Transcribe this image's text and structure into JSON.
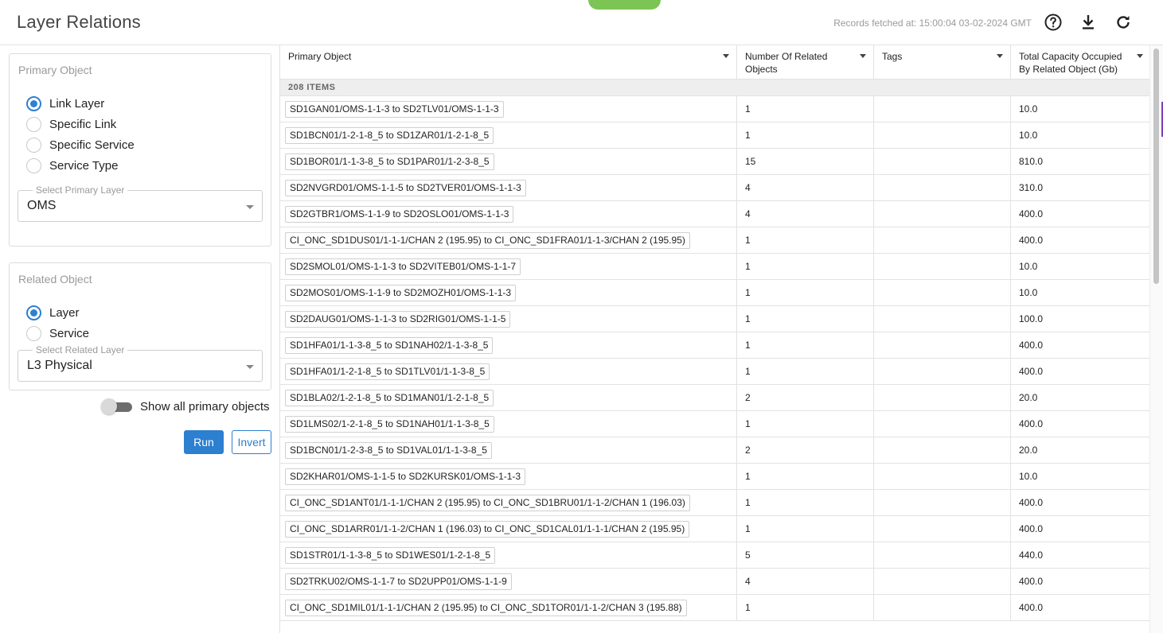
{
  "header": {
    "title": "Layer Relations",
    "fetched": "Records fetched at: 15:00:04 03-02-2024 GMT",
    "icons": [
      "help-icon",
      "download-icon",
      "refresh-icon"
    ]
  },
  "primary_panel": {
    "title": "Primary Object",
    "options": [
      "Link Layer",
      "Specific Link",
      "Specific Service",
      "Service Type"
    ],
    "selected": "Link Layer",
    "select_legend": "Select Primary Layer",
    "select_value": "OMS"
  },
  "related_panel": {
    "title": "Related Object",
    "options": [
      "Layer",
      "Service"
    ],
    "selected": "Layer",
    "select_legend": "Select Related Layer",
    "select_value": "L3 Physical"
  },
  "toggle": {
    "label": "Show all primary objects",
    "on": false
  },
  "buttons": {
    "run": "Run",
    "invert": "Invert"
  },
  "table": {
    "columns": [
      "Primary Object",
      "Number Of Related\nObjects",
      "Tags",
      "Total Capacity Occupied\nBy Related Object (Gb)"
    ],
    "group_label": "208 ITEMS",
    "rows": [
      [
        "SD1GAN01/OMS-1-1-3 to SD2TLV01/OMS-1-1-3",
        "1",
        "",
        "10.0"
      ],
      [
        "SD1BCN01/1-2-1-8_5 to SD1ZAR01/1-2-1-8_5",
        "1",
        "",
        "10.0"
      ],
      [
        "SD1BOR01/1-1-3-8_5 to SD1PAR01/1-2-3-8_5",
        "15",
        "",
        "810.0"
      ],
      [
        "SD2NVGRD01/OMS-1-1-5 to SD2TVER01/OMS-1-1-3",
        "4",
        "",
        "310.0"
      ],
      [
        "SD2GTBR1/OMS-1-1-9 to SD2OSLO01/OMS-1-1-3",
        "4",
        "",
        "400.0"
      ],
      [
        "CI_ONC_SD1DUS01/1-1-1/CHAN 2 (195.95) to CI_ONC_SD1FRA01/1-1-3/CHAN 2 (195.95)",
        "1",
        "",
        "400.0"
      ],
      [
        "SD2SMOL01/OMS-1-1-3 to SD2VITEB01/OMS-1-1-7",
        "1",
        "",
        "10.0"
      ],
      [
        "SD2MOS01/OMS-1-1-9 to SD2MOZH01/OMS-1-1-3",
        "1",
        "",
        "10.0"
      ],
      [
        "SD2DAUG01/OMS-1-1-3 to SD2RIG01/OMS-1-1-5",
        "1",
        "",
        "100.0"
      ],
      [
        "SD1HFA01/1-1-3-8_5 to SD1NAH02/1-1-3-8_5",
        "1",
        "",
        "400.0"
      ],
      [
        "SD1HFA01/1-2-1-8_5 to SD1TLV01/1-1-3-8_5",
        "1",
        "",
        "400.0"
      ],
      [
        "SD1BLA02/1-2-1-8_5 to SD1MAN01/1-2-1-8_5",
        "2",
        "",
        "20.0"
      ],
      [
        "SD1LMS02/1-2-1-8_5 to SD1NAH01/1-1-3-8_5",
        "1",
        "",
        "400.0"
      ],
      [
        "SD1BCN01/1-2-3-8_5 to SD1VAL01/1-1-3-8_5",
        "2",
        "",
        "20.0"
      ],
      [
        "SD2KHAR01/OMS-1-1-5 to SD2KURSK01/OMS-1-1-3",
        "1",
        "",
        "10.0"
      ],
      [
        "CI_ONC_SD1ANT01/1-1-1/CHAN 2 (195.95) to CI_ONC_SD1BRU01/1-1-2/CHAN 1 (196.03)",
        "1",
        "",
        "400.0"
      ],
      [
        "CI_ONC_SD1ARR01/1-1-2/CHAN 1 (196.03) to CI_ONC_SD1CAL01/1-1-1/CHAN 2 (195.95)",
        "1",
        "",
        "400.0"
      ],
      [
        "SD1STR01/1-1-3-8_5 to SD1WES01/1-2-1-8_5",
        "5",
        "",
        "440.0"
      ],
      [
        "SD2TRKU02/OMS-1-1-7 to SD2UPP01/OMS-1-1-9",
        "4",
        "",
        "400.0"
      ],
      [
        "CI_ONC_SD1MIL01/1-1-1/CHAN 2 (195.95) to CI_ONC_SD1TOR01/1-1-2/CHAN 3 (195.88)",
        "1",
        "",
        "400.0"
      ]
    ]
  },
  "colors": {
    "accent": "#2d7fd0",
    "green_tab": "#7cc554",
    "group_bg": "#eeeeee"
  }
}
